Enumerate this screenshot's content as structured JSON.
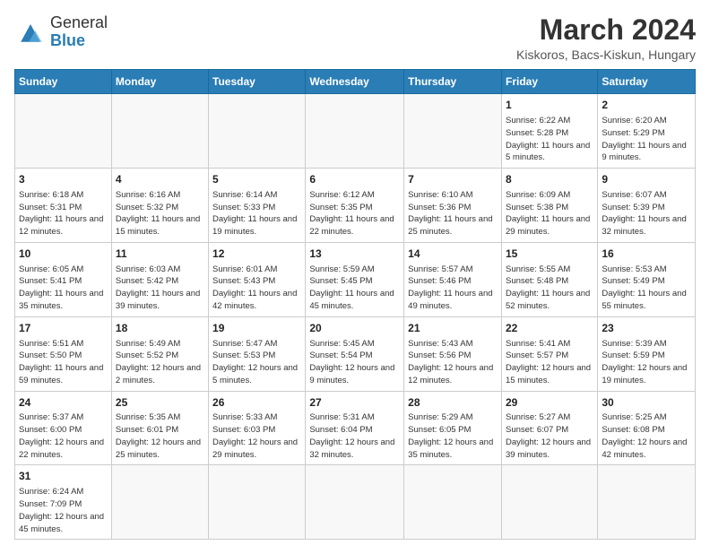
{
  "header": {
    "logo_line1": "General",
    "logo_line2": "Blue",
    "month_year": "March 2024",
    "location": "Kiskoros, Bacs-Kiskun, Hungary"
  },
  "days_of_week": [
    "Sunday",
    "Monday",
    "Tuesday",
    "Wednesday",
    "Thursday",
    "Friday",
    "Saturday"
  ],
  "weeks": [
    [
      {
        "day": "",
        "info": ""
      },
      {
        "day": "",
        "info": ""
      },
      {
        "day": "",
        "info": ""
      },
      {
        "day": "",
        "info": ""
      },
      {
        "day": "",
        "info": ""
      },
      {
        "day": "1",
        "info": "Sunrise: 6:22 AM\nSunset: 5:28 PM\nDaylight: 11 hours and 5 minutes."
      },
      {
        "day": "2",
        "info": "Sunrise: 6:20 AM\nSunset: 5:29 PM\nDaylight: 11 hours and 9 minutes."
      }
    ],
    [
      {
        "day": "3",
        "info": "Sunrise: 6:18 AM\nSunset: 5:31 PM\nDaylight: 11 hours and 12 minutes."
      },
      {
        "day": "4",
        "info": "Sunrise: 6:16 AM\nSunset: 5:32 PM\nDaylight: 11 hours and 15 minutes."
      },
      {
        "day": "5",
        "info": "Sunrise: 6:14 AM\nSunset: 5:33 PM\nDaylight: 11 hours and 19 minutes."
      },
      {
        "day": "6",
        "info": "Sunrise: 6:12 AM\nSunset: 5:35 PM\nDaylight: 11 hours and 22 minutes."
      },
      {
        "day": "7",
        "info": "Sunrise: 6:10 AM\nSunset: 5:36 PM\nDaylight: 11 hours and 25 minutes."
      },
      {
        "day": "8",
        "info": "Sunrise: 6:09 AM\nSunset: 5:38 PM\nDaylight: 11 hours and 29 minutes."
      },
      {
        "day": "9",
        "info": "Sunrise: 6:07 AM\nSunset: 5:39 PM\nDaylight: 11 hours and 32 minutes."
      }
    ],
    [
      {
        "day": "10",
        "info": "Sunrise: 6:05 AM\nSunset: 5:41 PM\nDaylight: 11 hours and 35 minutes."
      },
      {
        "day": "11",
        "info": "Sunrise: 6:03 AM\nSunset: 5:42 PM\nDaylight: 11 hours and 39 minutes."
      },
      {
        "day": "12",
        "info": "Sunrise: 6:01 AM\nSunset: 5:43 PM\nDaylight: 11 hours and 42 minutes."
      },
      {
        "day": "13",
        "info": "Sunrise: 5:59 AM\nSunset: 5:45 PM\nDaylight: 11 hours and 45 minutes."
      },
      {
        "day": "14",
        "info": "Sunrise: 5:57 AM\nSunset: 5:46 PM\nDaylight: 11 hours and 49 minutes."
      },
      {
        "day": "15",
        "info": "Sunrise: 5:55 AM\nSunset: 5:48 PM\nDaylight: 11 hours and 52 minutes."
      },
      {
        "day": "16",
        "info": "Sunrise: 5:53 AM\nSunset: 5:49 PM\nDaylight: 11 hours and 55 minutes."
      }
    ],
    [
      {
        "day": "17",
        "info": "Sunrise: 5:51 AM\nSunset: 5:50 PM\nDaylight: 11 hours and 59 minutes."
      },
      {
        "day": "18",
        "info": "Sunrise: 5:49 AM\nSunset: 5:52 PM\nDaylight: 12 hours and 2 minutes."
      },
      {
        "day": "19",
        "info": "Sunrise: 5:47 AM\nSunset: 5:53 PM\nDaylight: 12 hours and 5 minutes."
      },
      {
        "day": "20",
        "info": "Sunrise: 5:45 AM\nSunset: 5:54 PM\nDaylight: 12 hours and 9 minutes."
      },
      {
        "day": "21",
        "info": "Sunrise: 5:43 AM\nSunset: 5:56 PM\nDaylight: 12 hours and 12 minutes."
      },
      {
        "day": "22",
        "info": "Sunrise: 5:41 AM\nSunset: 5:57 PM\nDaylight: 12 hours and 15 minutes."
      },
      {
        "day": "23",
        "info": "Sunrise: 5:39 AM\nSunset: 5:59 PM\nDaylight: 12 hours and 19 minutes."
      }
    ],
    [
      {
        "day": "24",
        "info": "Sunrise: 5:37 AM\nSunset: 6:00 PM\nDaylight: 12 hours and 22 minutes."
      },
      {
        "day": "25",
        "info": "Sunrise: 5:35 AM\nSunset: 6:01 PM\nDaylight: 12 hours and 25 minutes."
      },
      {
        "day": "26",
        "info": "Sunrise: 5:33 AM\nSunset: 6:03 PM\nDaylight: 12 hours and 29 minutes."
      },
      {
        "day": "27",
        "info": "Sunrise: 5:31 AM\nSunset: 6:04 PM\nDaylight: 12 hours and 32 minutes."
      },
      {
        "day": "28",
        "info": "Sunrise: 5:29 AM\nSunset: 6:05 PM\nDaylight: 12 hours and 35 minutes."
      },
      {
        "day": "29",
        "info": "Sunrise: 5:27 AM\nSunset: 6:07 PM\nDaylight: 12 hours and 39 minutes."
      },
      {
        "day": "30",
        "info": "Sunrise: 5:25 AM\nSunset: 6:08 PM\nDaylight: 12 hours and 42 minutes."
      }
    ],
    [
      {
        "day": "31",
        "info": "Sunrise: 6:24 AM\nSunset: 7:09 PM\nDaylight: 12 hours and 45 minutes."
      },
      {
        "day": "",
        "info": ""
      },
      {
        "day": "",
        "info": ""
      },
      {
        "day": "",
        "info": ""
      },
      {
        "day": "",
        "info": ""
      },
      {
        "day": "",
        "info": ""
      },
      {
        "day": "",
        "info": ""
      }
    ]
  ]
}
